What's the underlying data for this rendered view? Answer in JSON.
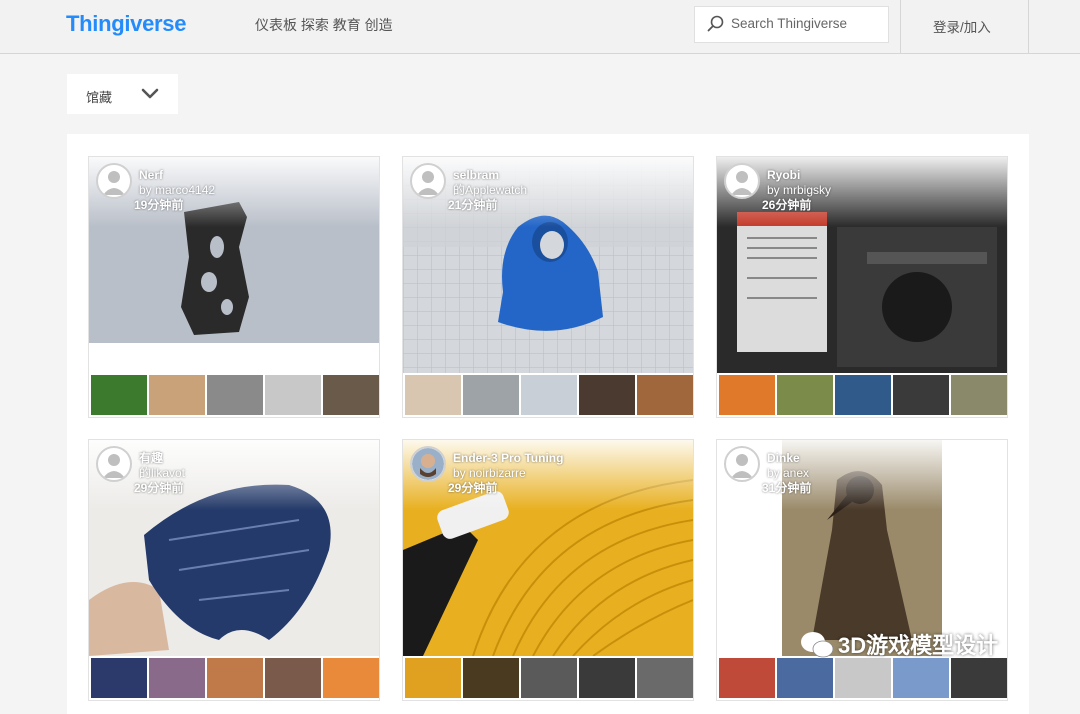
{
  "header": {
    "logo": "Thingiverse",
    "nav": "仪表板 探索 教育 创造",
    "search_placeholder": "Search Thingiverse",
    "login": "登录/加入"
  },
  "filter": {
    "selected": "馆藏"
  },
  "cards": [
    {
      "title": "Nerf",
      "user": "by marco4142",
      "time": "19分钟前",
      "main_colors": [
        "#b8bec8",
        "#2a2a2a"
      ],
      "thumbs": [
        "#3c7a2e",
        "#c9a27a",
        "#8a8a8a",
        "#c8c8c8",
        "#6a5a4a"
      ]
    },
    {
      "title": "selbram",
      "user": "的Applewatch",
      "time": "21分钟前",
      "main_colors": [
        "#cfd2d6",
        "#2466c7"
      ],
      "thumbs": [
        "#d9c6b0",
        "#9ea3a8",
        "#c9cfd6",
        "#4a3a30",
        "#a0673c"
      ]
    },
    {
      "title": "Ryobi",
      "user": "by mrbigsky",
      "time": "26分钟前",
      "main_colors": [
        "#2a2a2a",
        "#d8d8d8"
      ],
      "thumbs": [
        "#e07a2a",
        "#7a8b4a",
        "#2f5a8a",
        "#3a3a3a",
        "#8a8a6a"
      ]
    },
    {
      "title": "有趣",
      "user": "的likavot",
      "time": "29分钟前",
      "main_colors": [
        "#e8e6e2",
        "#243a6a"
      ],
      "thumbs": [
        "#2b3a6a",
        "#8a6a8a",
        "#c07a4a",
        "#7a5a4a",
        "#e88a3a"
      ]
    },
    {
      "title": "Ender-3 Pro Tuning",
      "user": "by noirbizarre",
      "time": "29分钟前",
      "main_colors": [
        "#e8b020",
        "#1a1a1a"
      ],
      "thumbs": [
        "#e0a020",
        "#4a3a20",
        "#5a5a5a",
        "#3a3a3a",
        "#6a6a6a"
      ]
    },
    {
      "title": "Dinke",
      "user": "by anex",
      "time": "31分钟前",
      "main_colors": [
        "#9a8a6a",
        "#4a3a2a"
      ],
      "thumbs": [
        "#c04a3a",
        "#4a6aa0",
        "#c8c8c8",
        "#7a9acb",
        "#3a3a3a"
      ]
    }
  ],
  "watermark": "3D游戏模型设计"
}
